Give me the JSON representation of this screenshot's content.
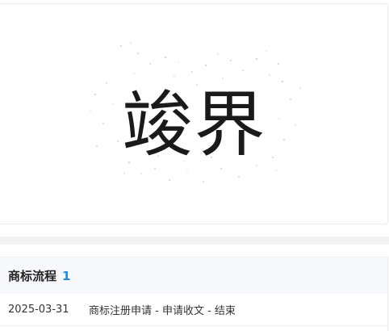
{
  "trademark": {
    "name": "竣界"
  },
  "process": {
    "title": "商标流程",
    "count": "1",
    "items": [
      {
        "date": "2025-03-31",
        "description": "商标注册申请 - 申请收文 - 结束"
      }
    ]
  }
}
